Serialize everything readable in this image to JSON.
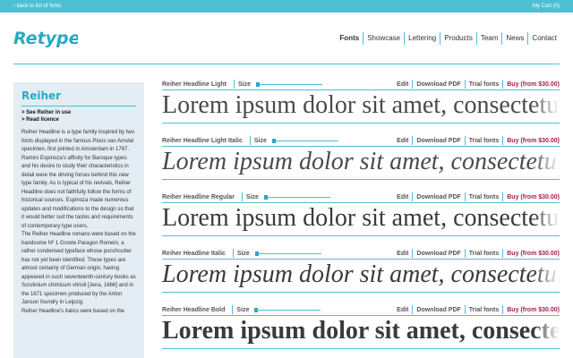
{
  "topbar": {
    "back_label": "‹ back to list of fonts",
    "cart_label": "My Cart (0)"
  },
  "logo": {
    "text": "Retype",
    "color": "#2aa9c3"
  },
  "nav": {
    "items": [
      "Fonts",
      "Showcase",
      "Lettering",
      "Products",
      "Team",
      "News",
      "Contact"
    ],
    "active": "Fonts"
  },
  "sidebar": {
    "title": "Reiher",
    "links": [
      "> See Reiher in use",
      "> Read licence"
    ],
    "paragraphs": [
      "Reiher Headline is a type family inspired by two fonts displayed in the famous Ploos van Amstel specimen, first printed in Amsterdam in 1767.",
      "Ramiro Espinoza's affinity for Baroque types and his desire to study their characteristics in detail were the driving forces behind this new type family. As is typical of his revivals, Reiher Headline does not faithfully follow the forms of historical sources. Espinoza made numerous updates and modifications to the design so that it would better suit the tastes and requirements of contemporary type users.",
      "The Reiher Headline romans were based on the handsome Nº 1 Groote Paragon Romein, a rather condensed typeface whose punchcutter has not yet been identified. These types are almost certainly of German origin, having appeared in such seventeenth-century books as Scrutinium chimicum vitrioli [Jena, 1666] and in the 1671 specimen produced by the Anton Janson foundry in Leipzig.",
      "Reiher Headline's italics were based on the"
    ]
  },
  "fonts": {
    "size_label": "Size",
    "size_level": 0,
    "actions": {
      "edit": "Edit",
      "download": "Download PDF",
      "trial": "Trial fonts",
      "buy": "Buy (from $30.00)"
    },
    "specimen_text": "Lorem ipsum dolor sit amet, consectetur adipiscing",
    "rows": [
      {
        "name": "Reiher Headline Light",
        "style": "light"
      },
      {
        "name": "Reiher Headline Light Italic",
        "style": "italic"
      },
      {
        "name": "Reiher Headline Regular",
        "style": "regular"
      },
      {
        "name": "Reiher Headline Italic",
        "style": "italic"
      },
      {
        "name": "Reiher Headline Bold",
        "style": "bold"
      }
    ]
  },
  "colors": {
    "accent": "#4dbfd3",
    "sidebar_bg": "#e3edf3",
    "buy": "#a01f4a"
  }
}
